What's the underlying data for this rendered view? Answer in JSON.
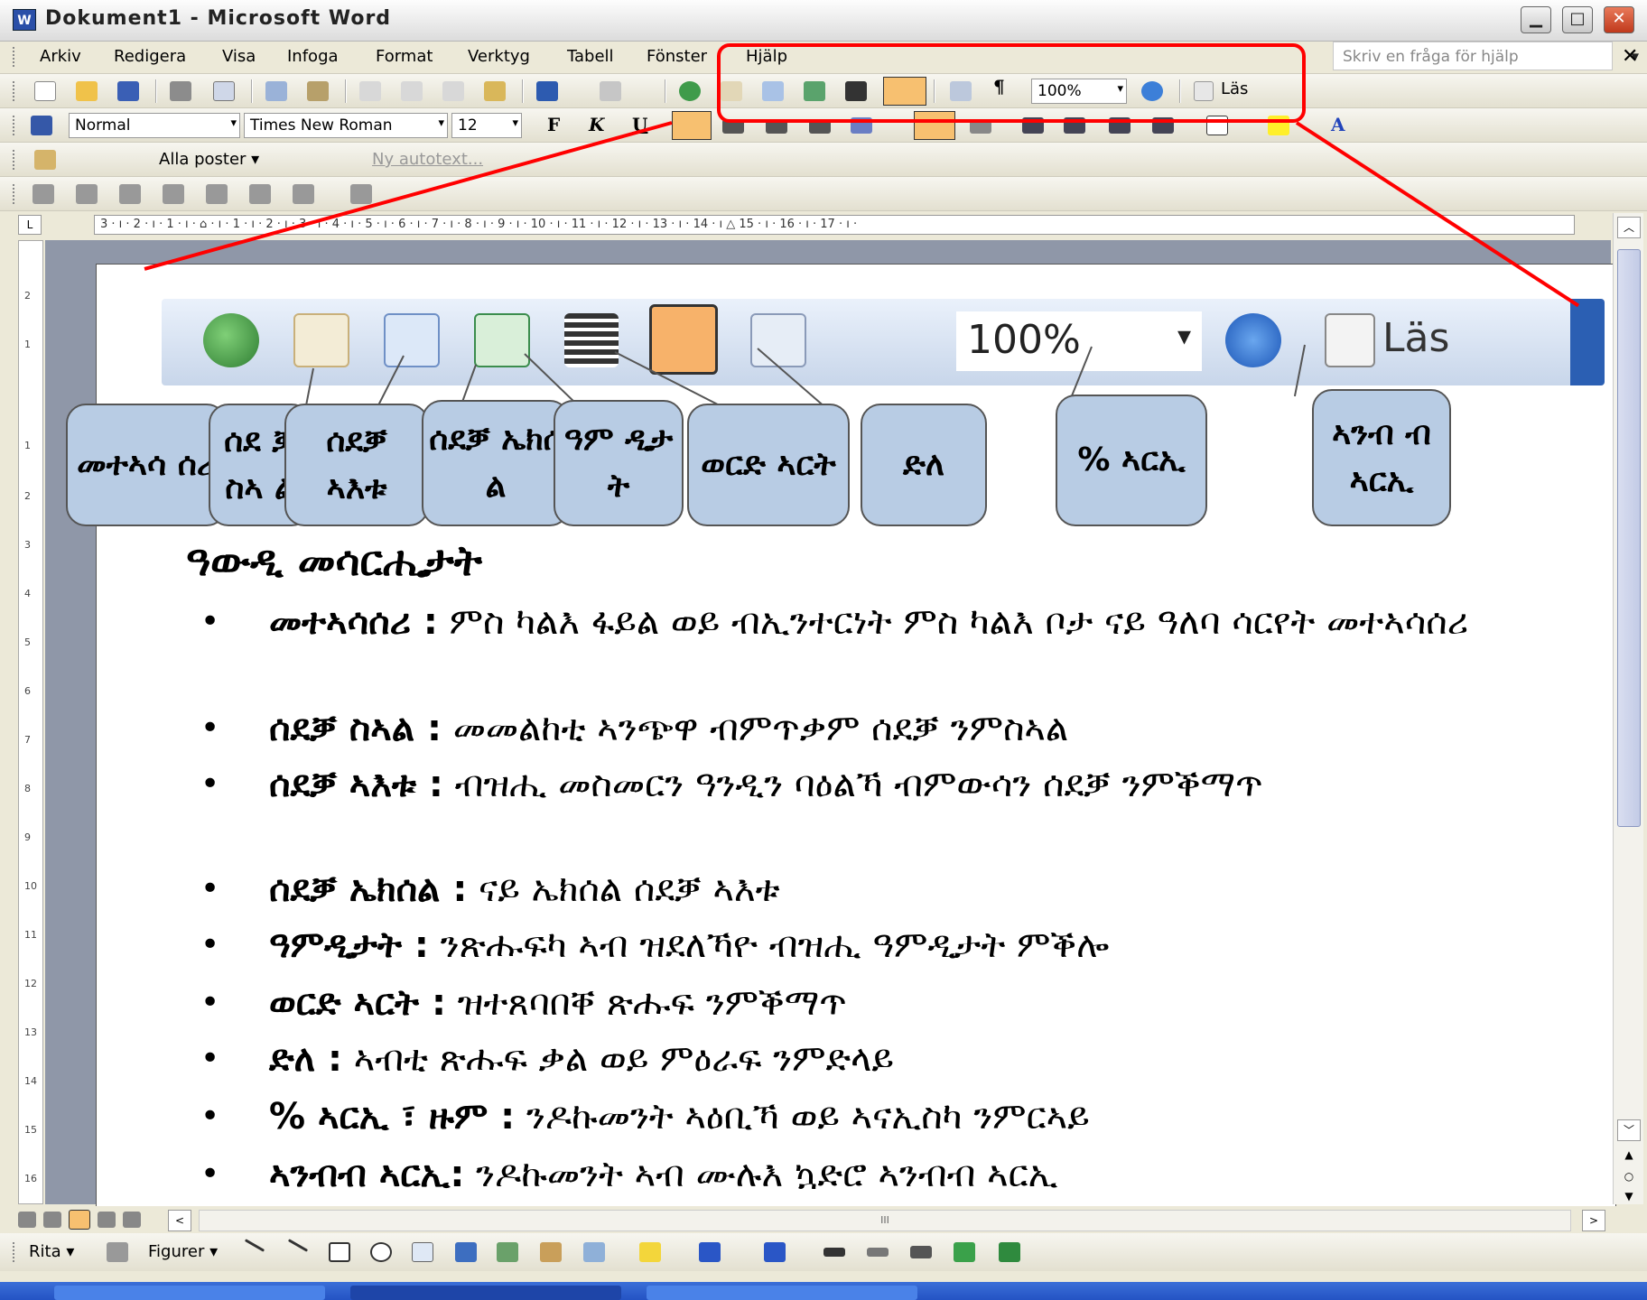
{
  "window": {
    "title": "Dokument1 - Microsoft Word",
    "icon_label": "W",
    "min": "▁",
    "max": "□",
    "close": "✕"
  },
  "menubar": {
    "items": [
      "Arkiv",
      "Redigera",
      "Visa",
      "Infoga",
      "Format",
      "Verktyg",
      "Tabell",
      "Fönster",
      "Hjälp"
    ],
    "help_placeholder": "Skriv en fråga för hjälp",
    "help_arrow": "▾",
    "close_doc": "✕"
  },
  "standard_toolbar": {
    "zoom": "100%",
    "read_label": "Läs",
    "para_mark": "¶"
  },
  "format_toolbar": {
    "style": "Normal",
    "font": "Times New Roman",
    "size": "12",
    "bold": "F",
    "italic": "K",
    "underline": "U",
    "font_color_glyph": "A",
    "highlight_glyph": "ab"
  },
  "autotext_toolbar": {
    "all_entries": "Alla poster ▾",
    "new_autotext": "Ny autotext..."
  },
  "ruler": {
    "marks": "3 · ı · 2 · ı · 1 · ı · ⌂ · ı · 1 · ı · 2 · ı · 3 · ı · 4 · ı · 5 · ı · 6 · ı · 7 · ı · 8 · ı · 9 · ı · 10 · ı · 11 · ı · 12 · ı · 13 · ı · 14 · ı △ 15 · ı · 16 · ı · 17 · ı ·",
    "tab_selector": "L"
  },
  "left_ruler": [
    "2",
    "1",
    "1",
    "2",
    "3",
    "4",
    "5",
    "6",
    "7",
    "8",
    "9",
    "10",
    "11",
    "12",
    "13",
    "14",
    "15",
    "16"
  ],
  "zoomed_toolbar": {
    "zoom": "100%",
    "read_label": "Läs",
    "arrow": "▾"
  },
  "callouts": [
    {
      "label": "መተኣሳ ሰሪ"
    },
    {
      "label": "ሰደ ቓ ስኣ ል"
    },
    {
      "label": "ሰደቓ ኣእቱ"
    },
    {
      "label": "ሰደቓ ኤክሰ ል"
    },
    {
      "label": "ዓም ዲታ ት"
    },
    {
      "label": "ወርድ ኣርት"
    },
    {
      "label": "ድለ"
    },
    {
      "label": "% ኣርኢ"
    },
    {
      "label": "ኣንብ ብ ኣርኢ"
    }
  ],
  "document": {
    "heading": "ዓውዲ መሳርሒታት",
    "bullet_char": "•",
    "bullets": [
      {
        "term": "መተኣሳሰሪ :",
        "desc": " ምስ ካልእ ፋይል ወይ ብኢንተርነት ምስ ካልእ ቦታ ናይ ዓለባ ሳርየት መተኣሳሰሪ"
      },
      {
        "term": "ሰደቓ ስኣል :",
        "desc": " መመልከቲ ኣንጭዋ ብምጥቃም ሰደቓ ንምስኣል"
      },
      {
        "term": "ሰደቓ ኣእቱ :",
        "desc": " ብዝሒ መስመርን ዓንዲን ባዕልኻ ብምውሳን ሰደቓ ንምቕማጥ"
      },
      {
        "term": "ሰደቓ ኤክሰል :",
        "desc": " ናይ ኤክሰል ሰደቓ ኣእቱ"
      },
      {
        "term": "ዓምዲታት :",
        "desc": " ንጽሑፍካ ኣብ ዝደለኻዮ ብዝሒ ዓምዲታት ምቕሎ"
      },
      {
        "term": "ወርድ ኣርት :",
        "desc": " ዝተጸባበቐ ጽሑፍ ንምቕማጥ"
      },
      {
        "term": "ድለ :",
        "desc": " ኣብቲ ጽሑፍ ቃል ወይ ምዕራፍ ንምድላይ"
      },
      {
        "term": "% ኣርኢ ፣ ዙም :",
        "desc": " ንዶኩመንት ኣዕቢኻ ወይ ኣናኢስካ ንምርኣይ"
      },
      {
        "term": "ኣንብብ ኣርኢ:",
        "desc": " ንዶኩመንት ኣብ ሙሉእ ኳድሮ ኣንብብ ኣርኢ"
      }
    ]
  },
  "scrollbar": {
    "up": "︿",
    "down": "﹀",
    "prev": "▲",
    "select": "○",
    "next": "▼",
    "hleft": "<",
    "hright": ">",
    "hcenter": "III"
  },
  "drawing_toolbar": {
    "draw": "Rita ▾",
    "shapes": "Figurer ▾"
  },
  "colors": {
    "callout_fill": "#b8cce4",
    "highlight": "#ff0000",
    "active_button": "#f7c070"
  }
}
